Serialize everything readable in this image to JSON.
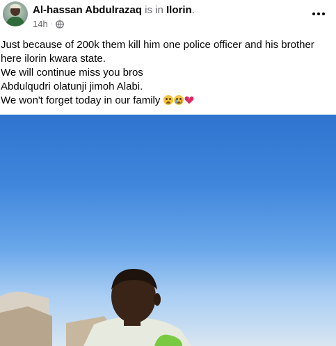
{
  "post": {
    "author": "Al-hassan Abdulrazaq",
    "is_in": "is in",
    "place": "Ilorin",
    "place_suffix": ".",
    "time": "14h",
    "dot": "·",
    "audience_icon": "globe-icon",
    "more_icon": "more-options-icon",
    "text_lines": [
      "Just because of 200k them kill him one police officer and his brother here ilorin kwara state.",
      "We will continue miss you bros",
      "Abdulqudri olatunji jimoh Alabi.",
      "We won't forget today in our family"
    ],
    "emoji_icons": [
      "pleading-face-emoji-icon",
      "crying-face-emoji-icon",
      "broken-heart-emoji-icon"
    ]
  },
  "colors": {
    "text_primary": "#050505",
    "text_secondary": "#65676b",
    "sky_top": "#2f74cf",
    "skin": "#3a2418",
    "shirt": "#e7eadf"
  }
}
